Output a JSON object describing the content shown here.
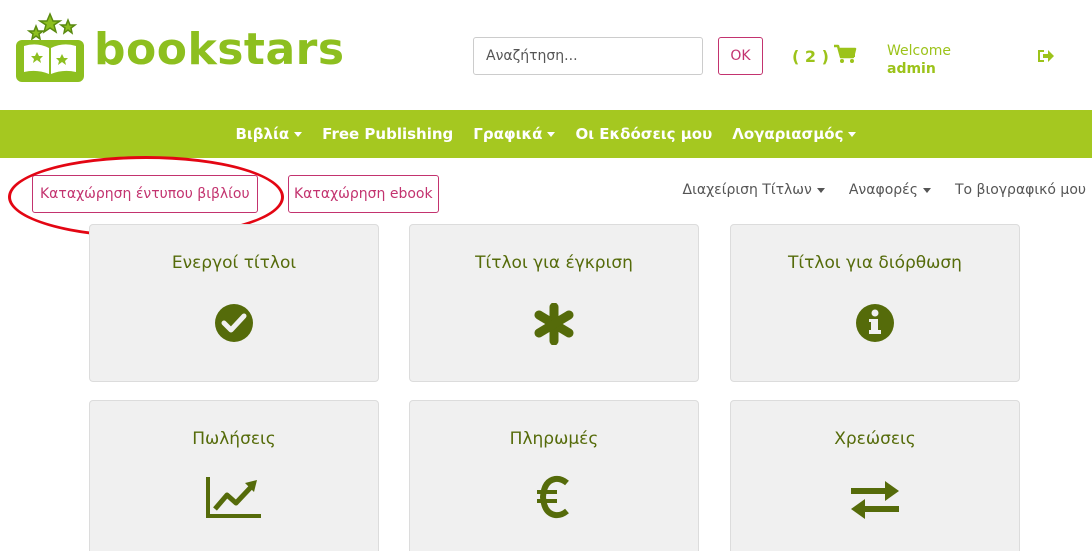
{
  "brand": {
    "name": "bookstars",
    "color": "#8dbf1f"
  },
  "search": {
    "placeholder": "Αναζήτηση...",
    "value": "",
    "submit_label": "OK"
  },
  "cart": {
    "count_label": "( 2 )"
  },
  "user": {
    "welcome_label": "Welcome",
    "username": "admin"
  },
  "nav": {
    "items": [
      {
        "label": "Βιβλία",
        "has_dropdown": true
      },
      {
        "label": "Free Publishing",
        "has_dropdown": false
      },
      {
        "label": "Γραφικά",
        "has_dropdown": true
      },
      {
        "label": "Οι Εκδόσεις μου",
        "has_dropdown": false
      },
      {
        "label": "Λογαριασμός",
        "has_dropdown": true
      }
    ],
    "color": "#a5c820"
  },
  "actions": {
    "register_print_label": "Καταχώρηση έντυπου βιβλίου",
    "register_ebook_label": "Καταχώρηση ebook",
    "highlight_color": "#e30613",
    "accent_color": "#c3336f"
  },
  "subnav": {
    "items": [
      {
        "label": "Διαχείριση Τίτλων",
        "has_dropdown": true
      },
      {
        "label": "Αναφορές",
        "has_dropdown": true
      },
      {
        "label": "Το βιογραφικό μου",
        "has_dropdown": false
      }
    ]
  },
  "cards": [
    {
      "title": "Ενεργοί τίτλοι",
      "icon": "check-circle-icon"
    },
    {
      "title": "Τίτλοι για έγκριση",
      "icon": "asterisk-icon"
    },
    {
      "title": "Τίτλοι για διόρθωση",
      "icon": "info-circle-icon"
    },
    {
      "title": "Πωλήσεις",
      "icon": "line-chart-icon"
    },
    {
      "title": "Πληρωμές",
      "icon": "euro-icon"
    },
    {
      "title": "Χρεώσεις",
      "icon": "exchange-icon"
    }
  ],
  "card_icon_color": "#556b0a"
}
